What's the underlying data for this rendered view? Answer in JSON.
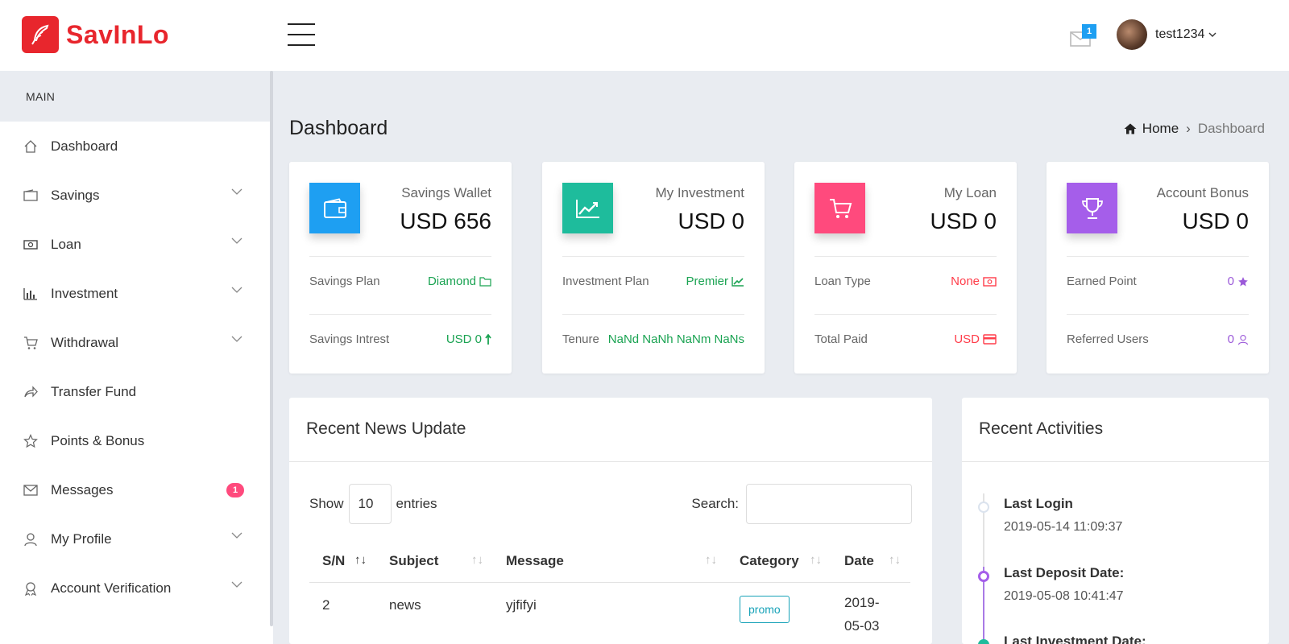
{
  "brand": {
    "name": "SavInLo",
    "color": "#e8262d"
  },
  "header": {
    "notification_count": "1",
    "username": "test1234"
  },
  "sidebar": {
    "section": "MAIN",
    "items": [
      {
        "label": "Dashboard",
        "icon": "home-icon",
        "chevron": false
      },
      {
        "label": "Savings",
        "icon": "wallet-icon",
        "chevron": true
      },
      {
        "label": "Loan",
        "icon": "money-icon",
        "chevron": true
      },
      {
        "label": "Investment",
        "icon": "bar-chart-icon",
        "chevron": true
      },
      {
        "label": "Withdrawal",
        "icon": "cart-icon",
        "chevron": true
      },
      {
        "label": "Transfer Fund",
        "icon": "share-icon",
        "chevron": false
      },
      {
        "label": "Points & Bonus",
        "icon": "star-icon",
        "chevron": false
      },
      {
        "label": "Messages",
        "icon": "envelope-icon",
        "chevron": false,
        "badge": "1"
      },
      {
        "label": "My Profile",
        "icon": "user-icon",
        "chevron": true
      },
      {
        "label": "Account Verification",
        "icon": "award-icon",
        "chevron": true
      }
    ]
  },
  "page": {
    "title": "Dashboard",
    "breadcrumb": {
      "home": "Home",
      "separator": "›",
      "current": "Dashboard"
    }
  },
  "cards": [
    {
      "label": "Savings Wallet",
      "value": "USD 656",
      "icon": "wallet-icon",
      "color": "#1e9ff2",
      "row1_label": "Savings Plan",
      "row1_value": "Diamond",
      "row1_icon": "folder-icon",
      "row2_label": "Savings Intrest",
      "row2_value": "USD 0",
      "row2_icon": "arrow-up-icon"
    },
    {
      "label": "My Investment",
      "value": "USD 0",
      "icon": "trend-icon",
      "color": "#1ebc9c",
      "row1_label": "Investment Plan",
      "row1_value": "Premier",
      "row1_icon": "line-chart-icon",
      "row2_label": "Tenure",
      "row2_value": "NaNd NaNh NaNm NaNs"
    },
    {
      "label": "My Loan",
      "value": "USD 0",
      "icon": "cart-icon",
      "color": "#ff4a7d",
      "row1_label": "Loan Type",
      "row1_value": "None",
      "row1_icon": "money-icon",
      "row2_label": "Total Paid",
      "row2_value": "USD",
      "row2_icon": "credit-card-icon"
    },
    {
      "label": "Account Bonus",
      "value": "USD 0",
      "icon": "trophy-icon",
      "color": "#a55eea",
      "row1_label": "Earned Point",
      "row1_value": "0",
      "row1_icon": "star-icon",
      "row2_label": "Referred Users",
      "row2_value": "0",
      "row2_icon": "user-icon"
    }
  ],
  "news": {
    "title": "Recent News Update",
    "show_label": "Show",
    "entries_value": "10",
    "entries_label": "entries",
    "search_label": "Search:",
    "columns": [
      "S/N",
      "Subject",
      "Message",
      "Category",
      "Date"
    ],
    "rows": [
      {
        "sn": "2",
        "subject": "news",
        "message": "yjfifyi",
        "category": "promo",
        "date_line1": "2019-",
        "date_line2": "05-03"
      }
    ]
  },
  "activities": {
    "title": "Recent Activities",
    "items": [
      {
        "title": "Last Login",
        "time": "2019-05-14 11:09:37"
      },
      {
        "title": "Last Deposit Date:",
        "time": "2019-05-08 10:41:47"
      },
      {
        "title": "Last Investment Date:",
        "time": ""
      }
    ]
  }
}
